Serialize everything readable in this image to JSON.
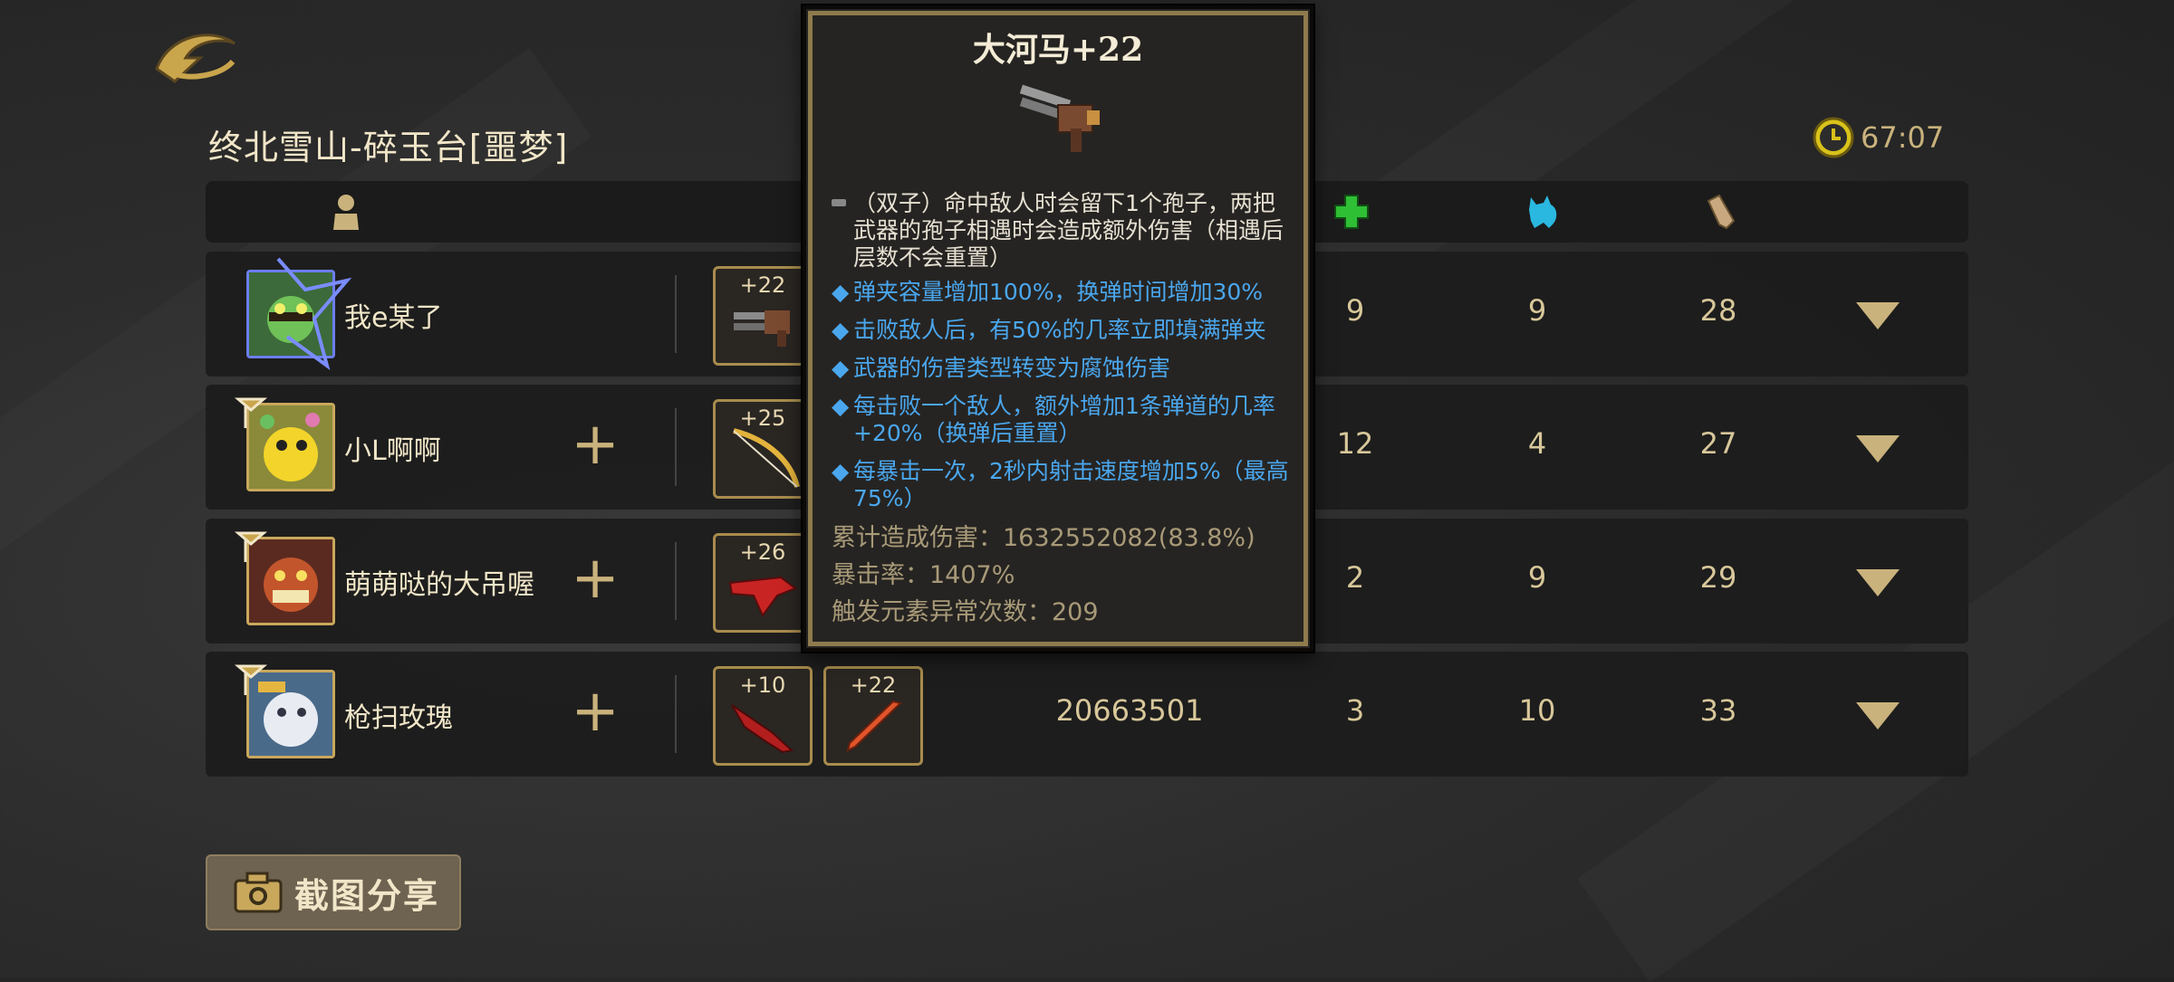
{
  "stage_title": "终北雪山-碎玉台[噩梦]",
  "timer": "67:07",
  "players": [
    {
      "name": "我e某了",
      "leader": true,
      "weapons": [
        "+22"
      ],
      "damage": "",
      "stat1": "9",
      "stat2": "9",
      "stat3": "28"
    },
    {
      "name": "小L啊啊",
      "leader": false,
      "weapons": [
        "+25"
      ],
      "damage": "",
      "stat1": "12",
      "stat2": "4",
      "stat3": "27"
    },
    {
      "name": "萌萌哒的大吊喔",
      "leader": false,
      "weapons": [
        "+26"
      ],
      "damage": "",
      "stat1": "2",
      "stat2": "9",
      "stat3": "29"
    },
    {
      "name": "枪扫玫瑰",
      "leader": false,
      "weapons": [
        "+10",
        "+22"
      ],
      "damage": "20663501",
      "stat1": "3",
      "stat2": "10",
      "stat3": "33"
    }
  ],
  "share_button": "截图分享",
  "tooltip": {
    "title": "大河马+22",
    "effect_main": "（双子）命中敌人时会留下1个孢子，两把武器的孢子相遇时会造成额外伤害（相遇后层数不会重置）",
    "effects": [
      "弹夹容量增加100%，换弹时间增加30%",
      "击败敌人后，有50%的几率立即填满弹夹",
      "武器的伤害类型转变为腐蚀伤害",
      "每击败一个敌人，额外增加1条弹道的几率+20%（换弹后重置）",
      "每暴击一次，2秒内射击速度增加5%（最高75%）"
    ],
    "bullet_glyph": "◆",
    "damage_total": "累计造成伤害：1632552082(83.8%)",
    "crit_rate": "暴击率：1407%",
    "elemental_count": "触发元素异常次数：209"
  },
  "icons": {
    "back": "back-arrow-icon",
    "player_col": "player-icon",
    "heal_col": "green-cross-icon",
    "pet_col": "cyan-cat-icon",
    "misc_col": "scroll-icon",
    "timer": "clock-icon",
    "camera": "camera-icon"
  },
  "colors": {
    "accent_gold": "#c9b27c",
    "effect_blue": "#4aa7ee",
    "heal_green": "#2fbf35",
    "pet_cyan": "#2ab8e0"
  }
}
